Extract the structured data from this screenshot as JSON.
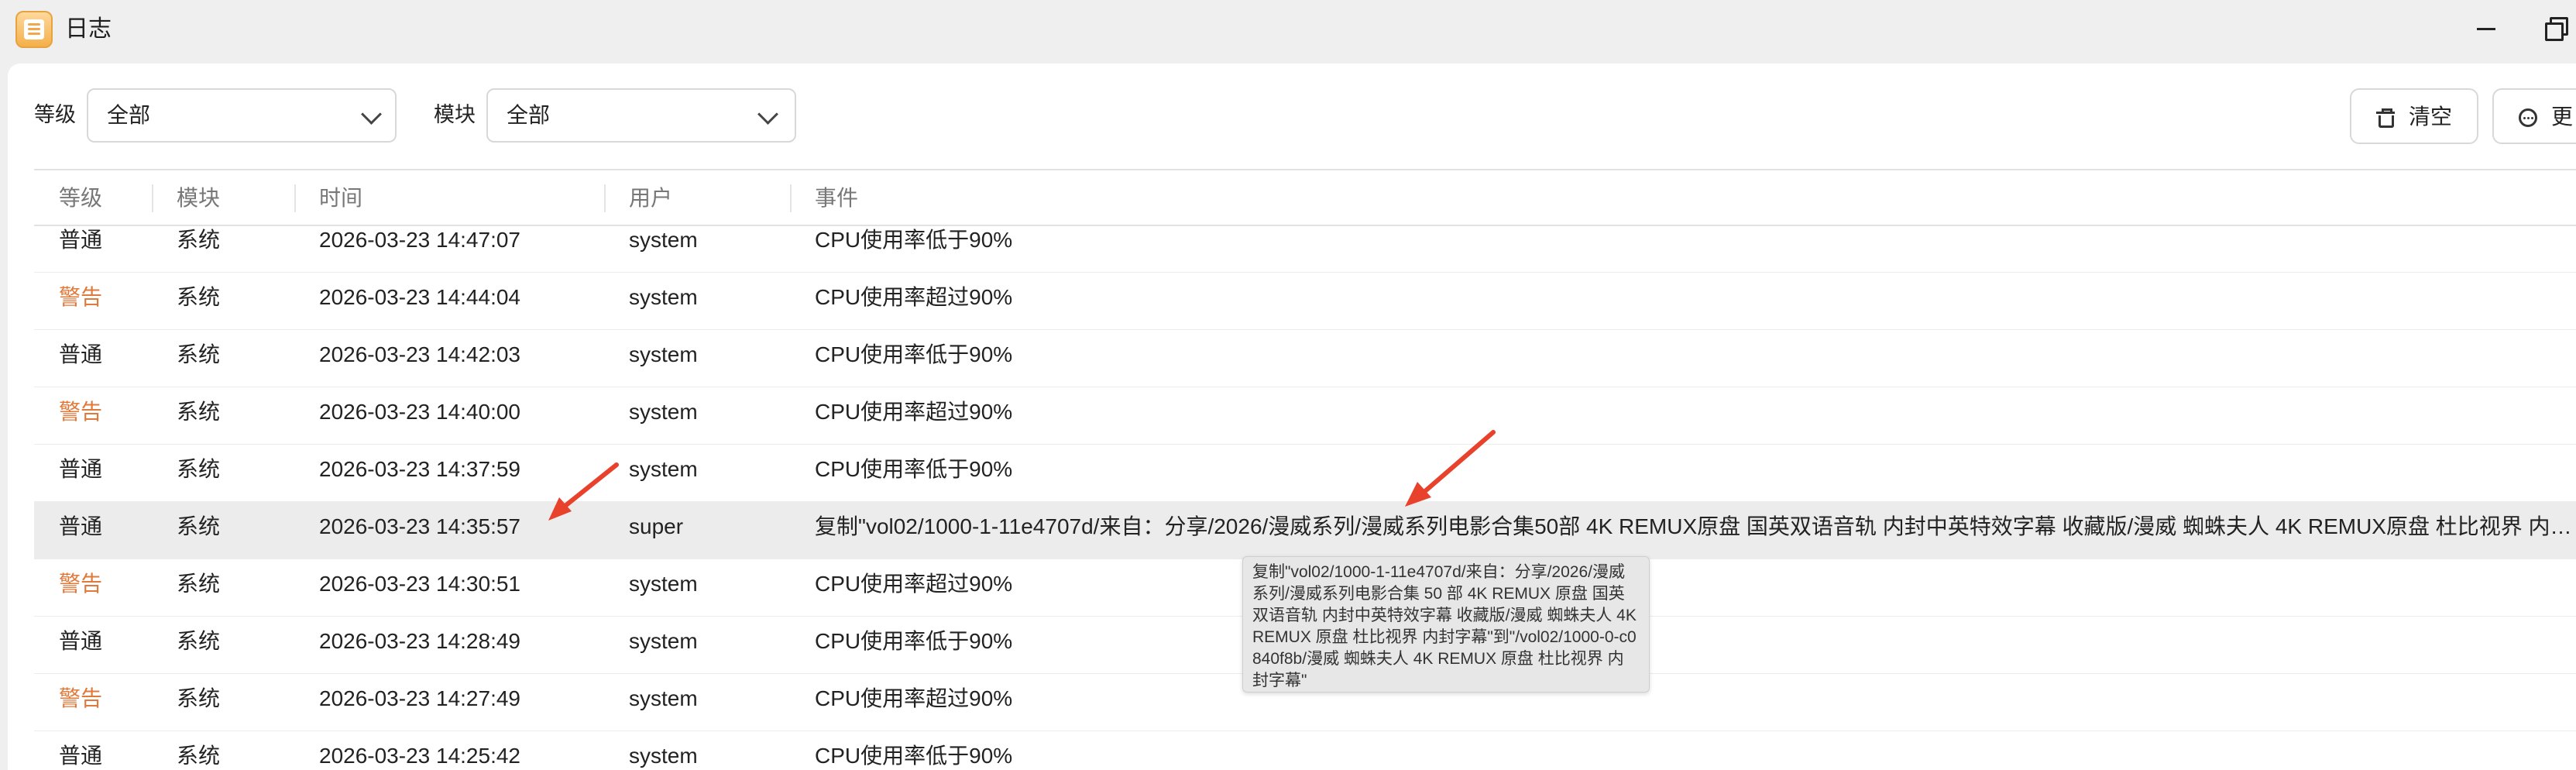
{
  "window": {
    "title": "日志",
    "icon": "log-app-icon",
    "controls": [
      "minimize-icon",
      "restore-icon"
    ]
  },
  "filters": {
    "level_label": "等级",
    "level_value": "全部",
    "module_label": "模块",
    "module_value": "全部"
  },
  "toolbar": {
    "clear_label": "清空",
    "more_label": "更"
  },
  "table": {
    "columns": [
      "等级",
      "模块",
      "时间",
      "用户",
      "事件"
    ],
    "rows": [
      {
        "level": "普通",
        "module": "系统",
        "time": "2026-03-23 14:47:07",
        "user": "system",
        "event": "CPU使用率低于90%"
      },
      {
        "level": "警告",
        "module": "系统",
        "time": "2026-03-23 14:44:04",
        "user": "system",
        "event": "CPU使用率超过90%"
      },
      {
        "level": "普通",
        "module": "系统",
        "time": "2026-03-23 14:42:03",
        "user": "system",
        "event": "CPU使用率低于90%"
      },
      {
        "level": "警告",
        "module": "系统",
        "time": "2026-03-23 14:40:00",
        "user": "system",
        "event": "CPU使用率超过90%"
      },
      {
        "level": "普通",
        "module": "系统",
        "time": "2026-03-23 14:37:59",
        "user": "system",
        "event": "CPU使用率低于90%"
      },
      {
        "level": "普通",
        "module": "系统",
        "time": "2026-03-23 14:35:57",
        "user": "super",
        "event": "复制\"vol02/1000-1-11e4707d/来自：分享/2026/漫威系列/漫威系列电影合集50部 4K REMUX原盘 国英双语音轨 内封中英特效字幕 收藏版/漫威 蜘蛛夫人 4K REMUX原盘 杜比视界 内封字幕\"到\"/vol02/1000-0-c0840f8b/漫威 蜘蛛夫人 4K REMUX原盘 杜比视界 内封字幕\""
      },
      {
        "level": "警告",
        "module": "系统",
        "time": "2026-03-23 14:30:51",
        "user": "system",
        "event": "CPU使用率超过90%"
      },
      {
        "level": "普通",
        "module": "系统",
        "time": "2026-03-23 14:28:49",
        "user": "system",
        "event": "CPU使用率低于90%"
      },
      {
        "level": "警告",
        "module": "系统",
        "time": "2026-03-23 14:27:49",
        "user": "system",
        "event": "CPU使用率超过90%"
      },
      {
        "level": "普通",
        "module": "系统",
        "time": "2026-03-23 14:25:42",
        "user": "system",
        "event": "CPU使用率低于90%"
      }
    ]
  },
  "tooltip": {
    "text": "复制\"vol02/1000-1-11e4707d/来自：分享/2026/漫威系列/漫威系列电影合集 50 部 4K REMUX 原盘 国英双语音轨 内封中英特效字幕 收藏版/漫威 蜘蛛夫人 4K REMUX 原盘 杜比视界 内封字幕\"到\"/vol02/1000-0-c0840f8b/漫威 蜘蛛夫人 4K REMUX 原盘 杜比视界 内封字幕\""
  },
  "colors": {
    "warning": "#e07a3b",
    "annotation_arrow": "#e8412c",
    "highlight_row": "#ececec"
  }
}
